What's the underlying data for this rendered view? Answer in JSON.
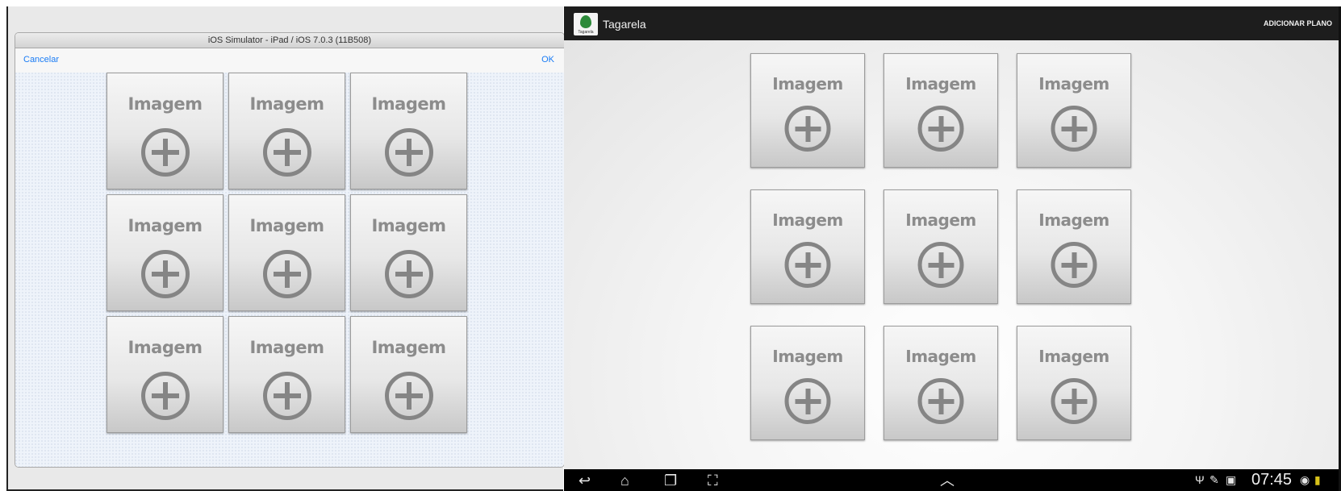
{
  "ios": {
    "window_title": "iOS Simulator - iPad / iOS 7.0.3 (11B508)",
    "cancel_label": "Cancelar",
    "ok_label": "OK",
    "tiles": [
      {
        "label": "Imagem"
      },
      {
        "label": "Imagem"
      },
      {
        "label": "Imagem"
      },
      {
        "label": "Imagem"
      },
      {
        "label": "Imagem"
      },
      {
        "label": "Imagem"
      },
      {
        "label": "Imagem"
      },
      {
        "label": "Imagem"
      },
      {
        "label": "Imagem"
      }
    ]
  },
  "android": {
    "app_title": "Tagarela",
    "app_icon_text": "Tagarela",
    "action_label": "ADICIONAR PLANO",
    "tiles": [
      {
        "label": "Imagem"
      },
      {
        "label": "Imagem"
      },
      {
        "label": "Imagem"
      },
      {
        "label": "Imagem"
      },
      {
        "label": "Imagem"
      },
      {
        "label": "Imagem"
      },
      {
        "label": "Imagem"
      },
      {
        "label": "Imagem"
      },
      {
        "label": "Imagem"
      }
    ],
    "nav": {
      "back_icon": "↩",
      "home_icon": "⌂",
      "recents_icon": "❐",
      "screenshot_icon": "⛶",
      "menu_up_icon": "︿"
    },
    "status": {
      "time": "07:45",
      "usb_icon": "Ψ",
      "pen_icon": "✎",
      "image_icon": "▣",
      "wifi_icon": "◉",
      "battery_icon": "▮"
    }
  }
}
